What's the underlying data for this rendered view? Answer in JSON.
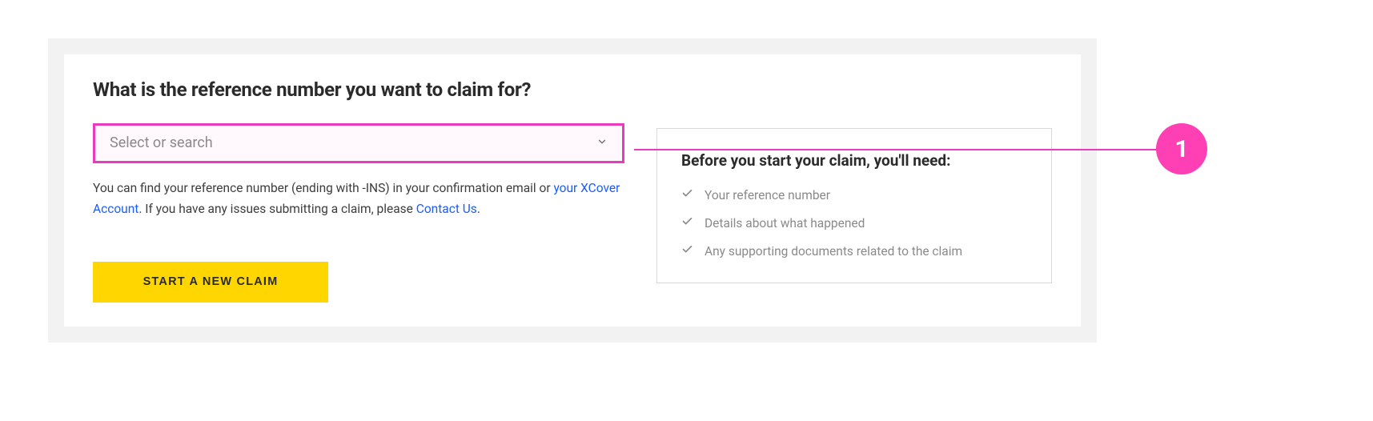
{
  "heading": "What is the reference number you want to claim for?",
  "select": {
    "placeholder": "Select or search"
  },
  "helper": {
    "part1": "You can find your reference number (ending with -INS) in your confirmation email or ",
    "link1": "your XCover Account",
    "part2": ". If you have any issues submitting a claim, please ",
    "link2": "Contact Us",
    "part3": "."
  },
  "cta_label": "START A NEW CLAIM",
  "info": {
    "title": "Before you start your claim, you'll need:",
    "items": [
      "Your reference number",
      "Details about what happened",
      "Any supporting documents related to the claim"
    ]
  },
  "annotation": {
    "badge": "1"
  }
}
